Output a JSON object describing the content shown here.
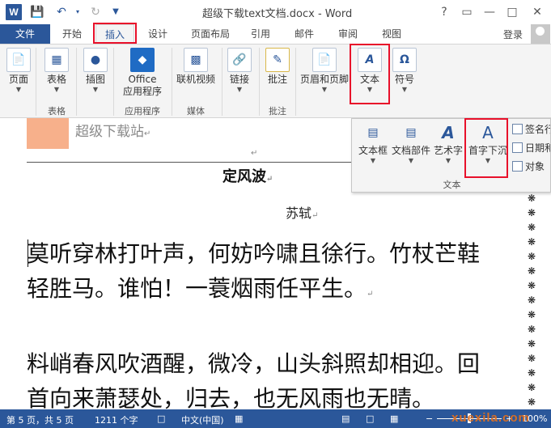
{
  "titlebar": {
    "app_icon": "W",
    "save_icon": "save-icon",
    "undo_icon": "undo-icon",
    "redo_icon": "redo-icon",
    "customize_icon": "customize-qat-icon",
    "title": "超级下载text文档.docx - Word",
    "help": "?",
    "minimize": "—",
    "maximize": "□",
    "close": "✕",
    "ribbon_options": "▭"
  },
  "tabs": {
    "file": "文件",
    "items": [
      "开始",
      "插入",
      "设计",
      "页面布局",
      "引用",
      "邮件",
      "审阅",
      "视图"
    ],
    "active": "插入",
    "login": "登录"
  },
  "ribbon": {
    "buttons": [
      "页面",
      "表格",
      "插图",
      "Office\n应用程序",
      "联机视频",
      "链接",
      "批注",
      "页眉和页脚",
      "文本",
      "符号"
    ],
    "groups": [
      "表格",
      "应用程序",
      "媒体",
      "批注"
    ]
  },
  "text_panel": {
    "buttons": [
      "文本框",
      "文档部件",
      "艺术字",
      "首字下沉"
    ],
    "side": [
      "签名行",
      "日期和",
      "对象"
    ],
    "group_label": "文本"
  },
  "document": {
    "header_text": "超级下载站",
    "title": "定风波",
    "author": "苏轼",
    "para1": "莫听穿林打叶声，何妨吟啸且徐行。竹杖芒鞋轻胜马。谁怕！一蓑烟雨任平生。",
    "para2": "料峭春风吹酒醒，微冷，山头斜照却相迎。回首向来萧瑟处，归去，也无风雨也无晴。"
  },
  "statusbar": {
    "page": "第 5 页，共 5 页",
    "words": "1211 个字",
    "language": "中文(中国)",
    "zoom": "100%"
  },
  "watermark": "xuexila.com",
  "colors": {
    "accent": "#2b579a",
    "highlight_box": "#e8102a"
  }
}
